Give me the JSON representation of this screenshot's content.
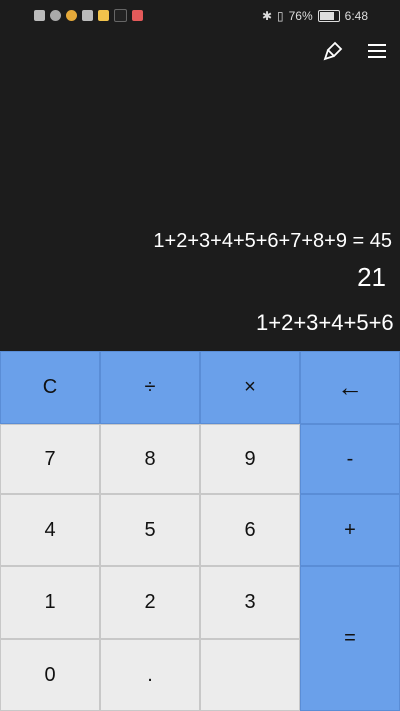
{
  "status": {
    "battery": "76%",
    "time": "6:48",
    "battery_level": 0.76
  },
  "display": {
    "history": "1+2+3+4+5+6+7+8+9 = 45",
    "result": "21",
    "input": "1+2+3+4+5+6"
  },
  "keys": {
    "clear": "C",
    "divide": "÷",
    "multiply": "×",
    "backspace": "←",
    "seven": "7",
    "eight": "8",
    "nine": "9",
    "minus": "-",
    "four": "4",
    "five": "5",
    "six": "6",
    "plus": "+",
    "one": "1",
    "two": "2",
    "three": "3",
    "equals": "=",
    "zero": "0",
    "dot": "."
  },
  "colors": {
    "operator": "#6aa0ea",
    "number": "#ececec",
    "display_bg": "#1c1c1c"
  }
}
